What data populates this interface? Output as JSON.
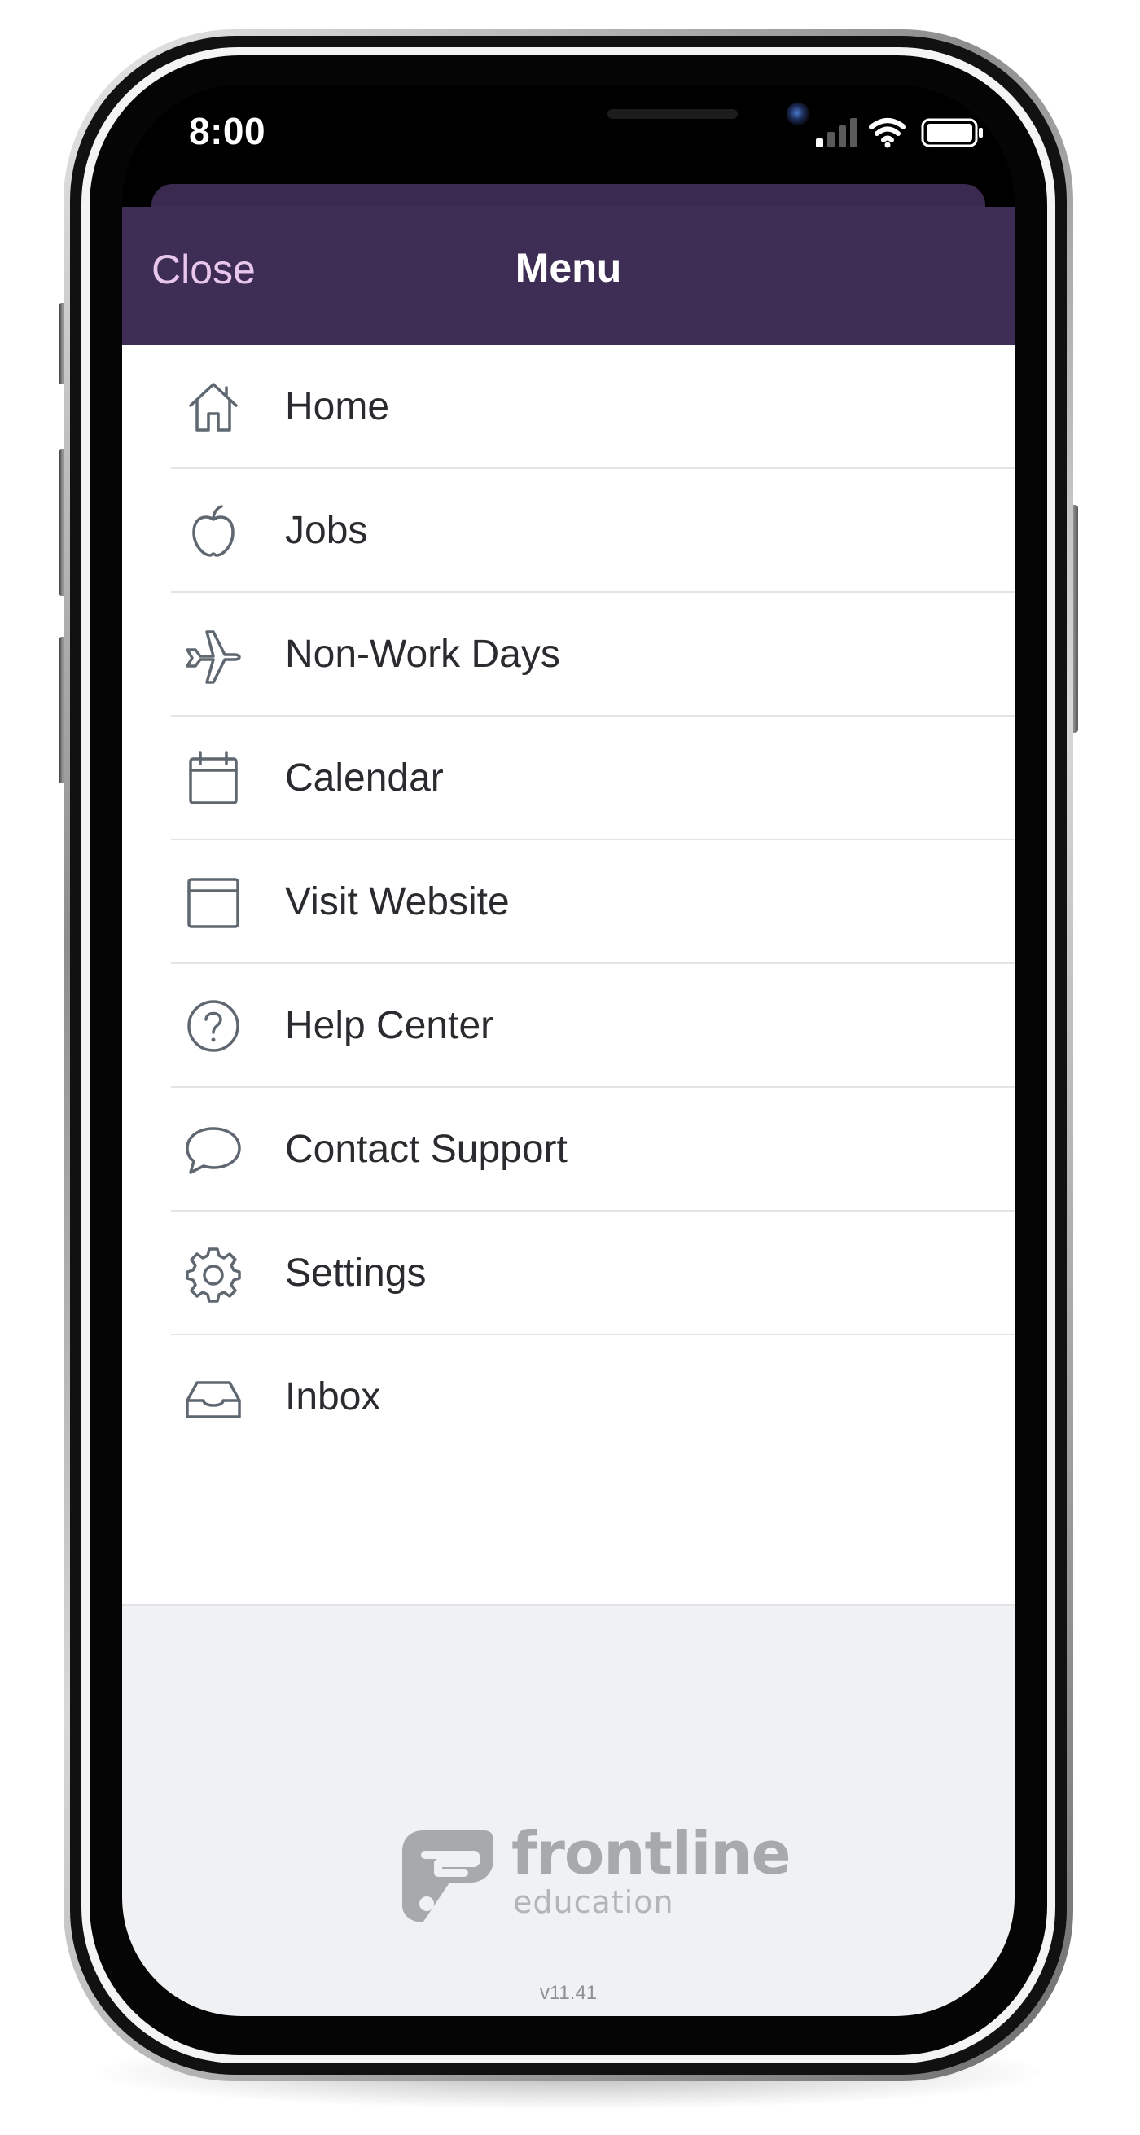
{
  "status_bar": {
    "time": "8:00"
  },
  "header": {
    "close_label": "Close",
    "title": "Menu"
  },
  "menu": {
    "items": [
      {
        "label": "Home",
        "icon": "home-icon"
      },
      {
        "label": "Jobs",
        "icon": "apple-icon"
      },
      {
        "label": "Non-Work Days",
        "icon": "airplane-icon"
      },
      {
        "label": "Calendar",
        "icon": "calendar-icon"
      },
      {
        "label": "Visit Website",
        "icon": "browser-window-icon"
      },
      {
        "label": "Help Center",
        "icon": "question-circle-icon"
      },
      {
        "label": "Contact Support",
        "icon": "speech-bubble-icon"
      },
      {
        "label": "Settings",
        "icon": "gear-icon"
      },
      {
        "label": "Inbox",
        "icon": "inbox-tray-icon"
      }
    ]
  },
  "footer": {
    "brand": "frontline",
    "brand_sub": "education",
    "version": "v11.41"
  },
  "colors": {
    "header_bg": "#3e2d55",
    "close_text": "#e9c6ec",
    "icon_stroke": "#5f6770",
    "logo_gray": "#a7a9ad"
  }
}
